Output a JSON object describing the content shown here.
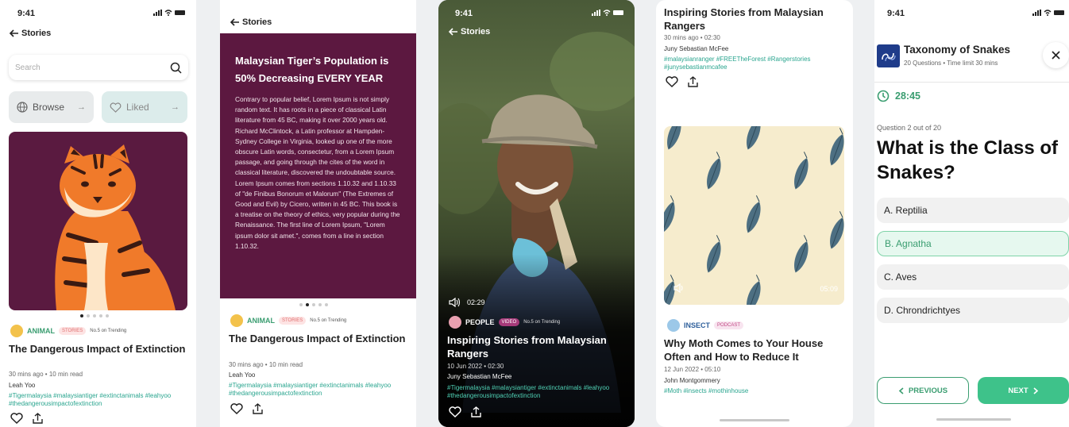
{
  "status_time": "9:41",
  "screen1": {
    "back_label": "Stories",
    "search_placeholder": "Search",
    "browse_label": "Browse",
    "liked_label": "Liked",
    "category": "ANIMAL",
    "pill": "STORIES",
    "trend": "No.5 on Trending",
    "title": "The Dangerous Impact of Extinction",
    "meta": "30 mins ago • 10 min read",
    "author": "Leah Yoo",
    "tags": "#Tigermalaysia #malaysiantiger #extinctanimals #leahyoo #thedangerousimpactofextinction"
  },
  "screen2": {
    "back_label": "Stories",
    "headline": "Malaysian Tiger’s Population is 50% Decreasing EVERY YEAR",
    "body": "Contrary to popular belief, Lorem Ipsum is not simply random text. It has roots in a piece of classical Latin literature from 45 BC, making it over 2000 years old. Richard McClintock, a Latin professor at Hampden-Sydney College in Virginia, looked up one of the more obscure Latin words, consectetur, from a Lorem Ipsum passage, and going through the cites of the word in classical literature, discovered the undoubtable source. Lorem Ipsum comes from sections 1.10.32 and 1.10.33 of \"de Finibus Bonorum et Malorum\" (The Extremes of Good and Evil) by Cicero, written in 45 BC. This book is a treatise on the theory of ethics, very popular during the Renaissance. The first line of Lorem Ipsum, \"Lorem ipsum dolor sit amet.\", comes from a line in section 1.10.32.",
    "category": "ANIMAL",
    "pill": "STORIES",
    "trend": "No.5 on Trending",
    "title": "The Dangerous Impact of Extinction",
    "meta": "30 mins ago • 10 min read",
    "author": "Leah Yoo",
    "tags": "#Tigermalaysia #malaysiantiger #extinctanimals #leahyoo #thedangerousimpactofextinction"
  },
  "screen3": {
    "back_label": "Stories",
    "duration": "02:29",
    "category": "PEOPLE",
    "pill": "VIDEO",
    "trend": "No.5 on Trending",
    "title": "Inspiring Stories from Malaysian Rangers",
    "meta": "10 Jun 2022 • 02:30",
    "author": "Juny Sebastian McFee",
    "tags": "#Tigermalaysia #malaysiantiger #extinctanimals #leahyoo #thedangerousimpactofextinction"
  },
  "screen4": {
    "top_title": "Inspiring Stories from Malaysian Rangers",
    "top_meta": "30 mins ago • 02:30",
    "top_author": "Juny Sebastian McFee",
    "top_tags": "#malaysianranger #FREETheForest #Rangerstories #junysebastianmcafee",
    "duration": "05:09",
    "category": "INSECT",
    "pill": "PODCAST",
    "title": "Why Moth Comes to Your House Often and How to Reduce It",
    "meta": "12 Jun 2022 • 05:10",
    "author": "John Montgommery",
    "tags": "#Moth #insects #mothinhouse"
  },
  "screen5": {
    "quiz_title": "Taxonomy of Snakes",
    "quiz_meta": "20 Questions • Time limit 30 mins",
    "timer": "28:45",
    "progress": "Question 2 out of 20",
    "question": "What is the Class of Snakes?",
    "options": [
      "A.  Reptilia",
      "B.  Agnatha",
      "C.  Aves",
      "D.  Chrondrichtyes"
    ],
    "selected_index": 1,
    "prev_label": "PREVIOUS",
    "next_label": "NEXT"
  },
  "colors": {
    "accent_green": "#3ec28a",
    "tag_teal": "#2aa58f",
    "story_purple": "#5c1840",
    "tiger_bg": "#5a1a40",
    "moth_bg": "#f6eccd",
    "browse_bg": "#e8ebec",
    "liked_bg": "#dceceb"
  },
  "icons": [
    "arrow-left-icon",
    "search-icon",
    "globe-icon",
    "heart-icon",
    "share-icon",
    "volume-icon",
    "timer-icon",
    "close-icon",
    "chevron-left-icon",
    "chevron-right-icon"
  ]
}
